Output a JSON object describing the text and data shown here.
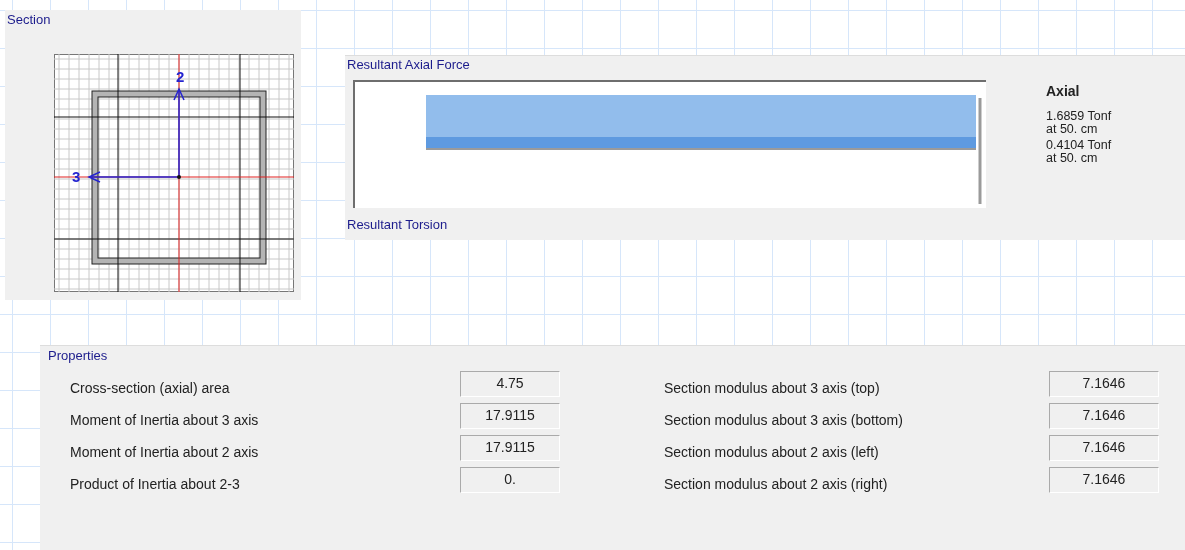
{
  "section": {
    "title": "Section",
    "axis_2_label": "2",
    "axis_3_label": "3"
  },
  "axial_force": {
    "title": "Resultant Axial Force",
    "legend_title": "Axial",
    "readings": [
      {
        "value": "1.6859 Tonf",
        "location": "at 50. cm"
      },
      {
        "value": "0.4104 Tonf",
        "location": "at 50. cm"
      }
    ]
  },
  "torsion": {
    "title": "Resultant Torsion"
  },
  "properties": {
    "title": "Properties",
    "left": [
      {
        "label": "Cross-section (axial) area",
        "value": "4.75"
      },
      {
        "label": "Moment of Inertia about 3 axis",
        "value": "17.9115"
      },
      {
        "label": "Moment of Inertia about 2 axis",
        "value": "17.9115"
      },
      {
        "label": "Product of Inertia about 2-3",
        "value": "0."
      }
    ],
    "right": [
      {
        "label": "Section modulus about 3 axis (top)",
        "value": "7.1646"
      },
      {
        "label": "Section modulus about 3 axis (bottom)",
        "value": "7.1646"
      },
      {
        "label": "Section modulus about 2 axis (left)",
        "value": "7.1646"
      },
      {
        "label": "Section modulus about 2 axis (right)",
        "value": "7.1646"
      }
    ]
  }
}
